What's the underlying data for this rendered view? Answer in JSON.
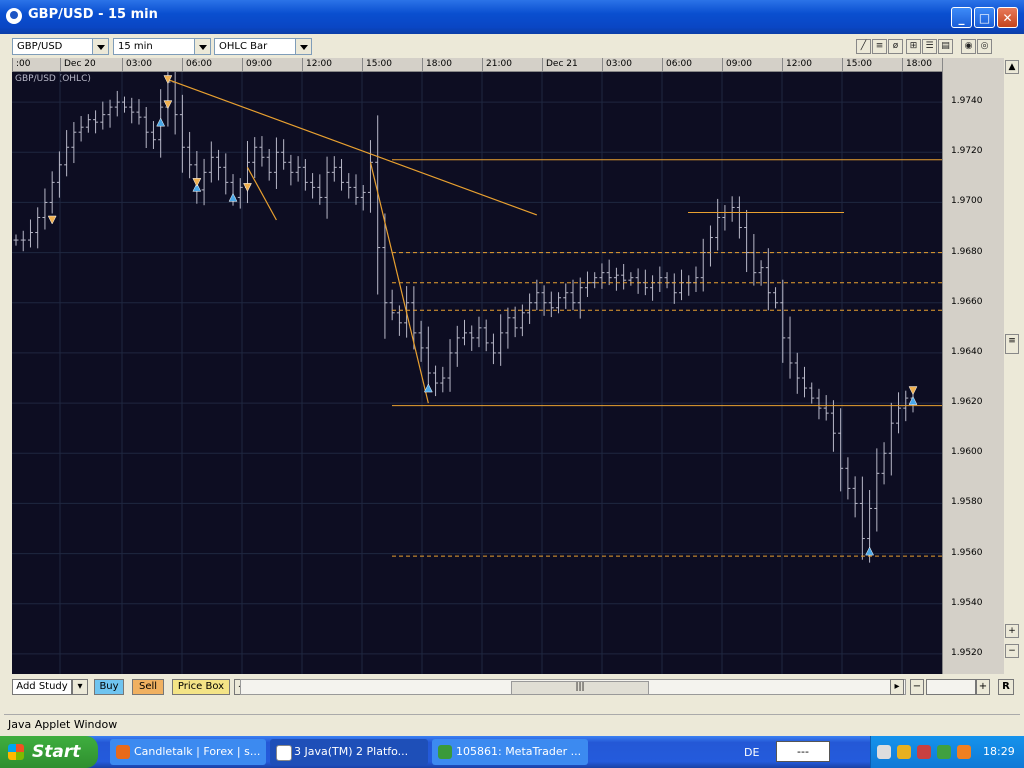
{
  "window": {
    "title": "GBP/USD - 15 min",
    "buttons": {
      "minimize": "_",
      "maximize": "□",
      "close": "✕"
    }
  },
  "toolbar": {
    "symbol": "GBP/USD",
    "period": "15 min",
    "chart_type": "OHLC Bar",
    "tools": [
      "line-tool",
      "channel-tool",
      "fibonacci-tool",
      "grid-tool",
      "levels-tool",
      "table-tool",
      "zoom-in-tool",
      "zoom-out-tool"
    ]
  },
  "chart": {
    "series_label": "GBP/USD (OHLC)",
    "colors": {
      "background": "#0d0d22",
      "bars": "#b8b8c8",
      "lines": "#e8a030",
      "up_marker": "#4aa8e8",
      "down_marker": "#f0b050"
    }
  },
  "chart_data": {
    "type": "ohlc",
    "symbol": "GBP/USD",
    "interval": "15 min",
    "x_ticks": [
      ":00",
      "Dec 20",
      "03:00",
      "06:00",
      "09:00",
      "12:00",
      "15:00",
      "18:00",
      "21:00",
      "Dec 21",
      "03:00",
      "06:00",
      "09:00",
      "12:00",
      "15:00",
      "18:00"
    ],
    "y_ticks": [
      "1.9740",
      "1.9720",
      "1.9700",
      "1.9680",
      "1.9660",
      "1.9640",
      "1.9620",
      "1.9600",
      "1.9580",
      "1.9560",
      "1.9540",
      "1.9520"
    ],
    "ylim": [
      1.9512,
      1.9752
    ],
    "close_path": [
      1.9685,
      1.9685,
      1.9688,
      1.9694,
      1.97,
      1.9708,
      1.9715,
      1.9722,
      1.9728,
      1.973,
      1.9733,
      1.9732,
      1.9735,
      1.9738,
      1.974,
      1.9738,
      1.9736,
      1.9734,
      1.9728,
      1.9725,
      1.9738,
      1.9748,
      1.9735,
      1.9722,
      1.9715,
      1.9705,
      1.9712,
      1.9718,
      1.9714,
      1.9708,
      1.9702,
      1.9706,
      1.9716,
      1.9722,
      1.9718,
      1.9712,
      1.972,
      1.9716,
      1.9712,
      1.9714,
      1.9708,
      1.9706,
      1.9702,
      1.9712,
      1.9714,
      1.9708,
      1.9706,
      1.9702,
      1.9704,
      1.9716,
      1.9682,
      1.966,
      1.9656,
      1.9652,
      1.966,
      1.9648,
      1.9642,
      1.9632,
      1.9628,
      1.963,
      1.964,
      1.9646,
      1.9648,
      1.9646,
      1.965,
      1.9644,
      1.964,
      1.9648,
      1.9654,
      1.965,
      1.9656,
      1.966,
      1.9664,
      1.966,
      1.9658,
      1.9662,
      1.9664,
      1.966,
      1.9666,
      1.9668,
      1.967,
      1.9672,
      1.967,
      1.9671,
      1.9669,
      1.967,
      1.9668,
      1.9666,
      1.9668,
      1.967,
      1.9668,
      1.9664,
      1.9668,
      1.9668,
      1.967,
      1.968,
      1.9686,
      1.9694,
      1.9696,
      1.9698,
      1.969,
      1.968,
      1.9672,
      1.9674,
      1.9664,
      1.966,
      1.9646,
      1.9636,
      1.963,
      1.9626,
      1.9622,
      1.9618,
      1.9616,
      1.9608,
      1.9594,
      1.9586,
      1.958,
      1.9566,
      1.9578,
      1.9592,
      1.96,
      1.9612,
      1.9618,
      1.9622,
      1.962
    ],
    "horizontal_levels": [
      {
        "price": 1.9717,
        "style": "solid"
      },
      {
        "price": 1.9696,
        "style": "solid"
      },
      {
        "price": 1.968,
        "style": "dashed"
      },
      {
        "price": 1.9668,
        "style": "dashed"
      },
      {
        "price": 1.9657,
        "style": "dashed"
      },
      {
        "price": 1.9619,
        "style": "solid"
      },
      {
        "price": 1.9559,
        "style": "dashed"
      }
    ],
    "trendlines": [
      {
        "from": [
          21,
          1.9749
        ],
        "to": [
          72,
          1.9695
        ]
      },
      {
        "from": [
          49,
          1.9716
        ],
        "to": [
          57,
          1.962
        ]
      },
      {
        "from": [
          32,
          1.9714
        ],
        "to": [
          36,
          1.9693
        ]
      }
    ],
    "markers": [
      {
        "i": 5,
        "price": 1.9693,
        "dir": "down"
      },
      {
        "i": 20,
        "price": 1.9732,
        "dir": "up"
      },
      {
        "i": 21,
        "price": 1.9749,
        "dir": "down"
      },
      {
        "i": 21,
        "price": 1.9739,
        "dir": "down"
      },
      {
        "i": 25,
        "price": 1.9706,
        "dir": "up"
      },
      {
        "i": 25,
        "price": 1.9708,
        "dir": "down"
      },
      {
        "i": 30,
        "price": 1.9702,
        "dir": "up"
      },
      {
        "i": 32,
        "price": 1.9706,
        "dir": "down"
      },
      {
        "i": 57,
        "price": 1.9626,
        "dir": "up"
      },
      {
        "i": 118,
        "price": 1.9561,
        "dir": "up"
      },
      {
        "i": 124,
        "price": 1.9621,
        "dir": "up"
      },
      {
        "i": 124,
        "price": 1.9625,
        "dir": "down"
      }
    ]
  },
  "bottom_bar": {
    "add_study": "Add Study",
    "buy": "Buy",
    "sell": "Sell",
    "price_box": "Price Box",
    "zoom_minus": "−",
    "zoom_plus": "+",
    "reset": "R",
    "thumb": "|||"
  },
  "status": {
    "applet": "Java Applet Window"
  },
  "taskbar": {
    "start": "Start",
    "tasks": [
      {
        "label": "Candletalk | Forex | s...",
        "color": "#e86a1a"
      },
      {
        "label": "3 Java(TM) 2 Platfo...",
        "color": "#ffffff"
      },
      {
        "label": "105861: MetaTrader ...",
        "color": "#3a9a3a"
      }
    ],
    "lang": "DE",
    "lbox": "---",
    "clock": "18:29"
  }
}
